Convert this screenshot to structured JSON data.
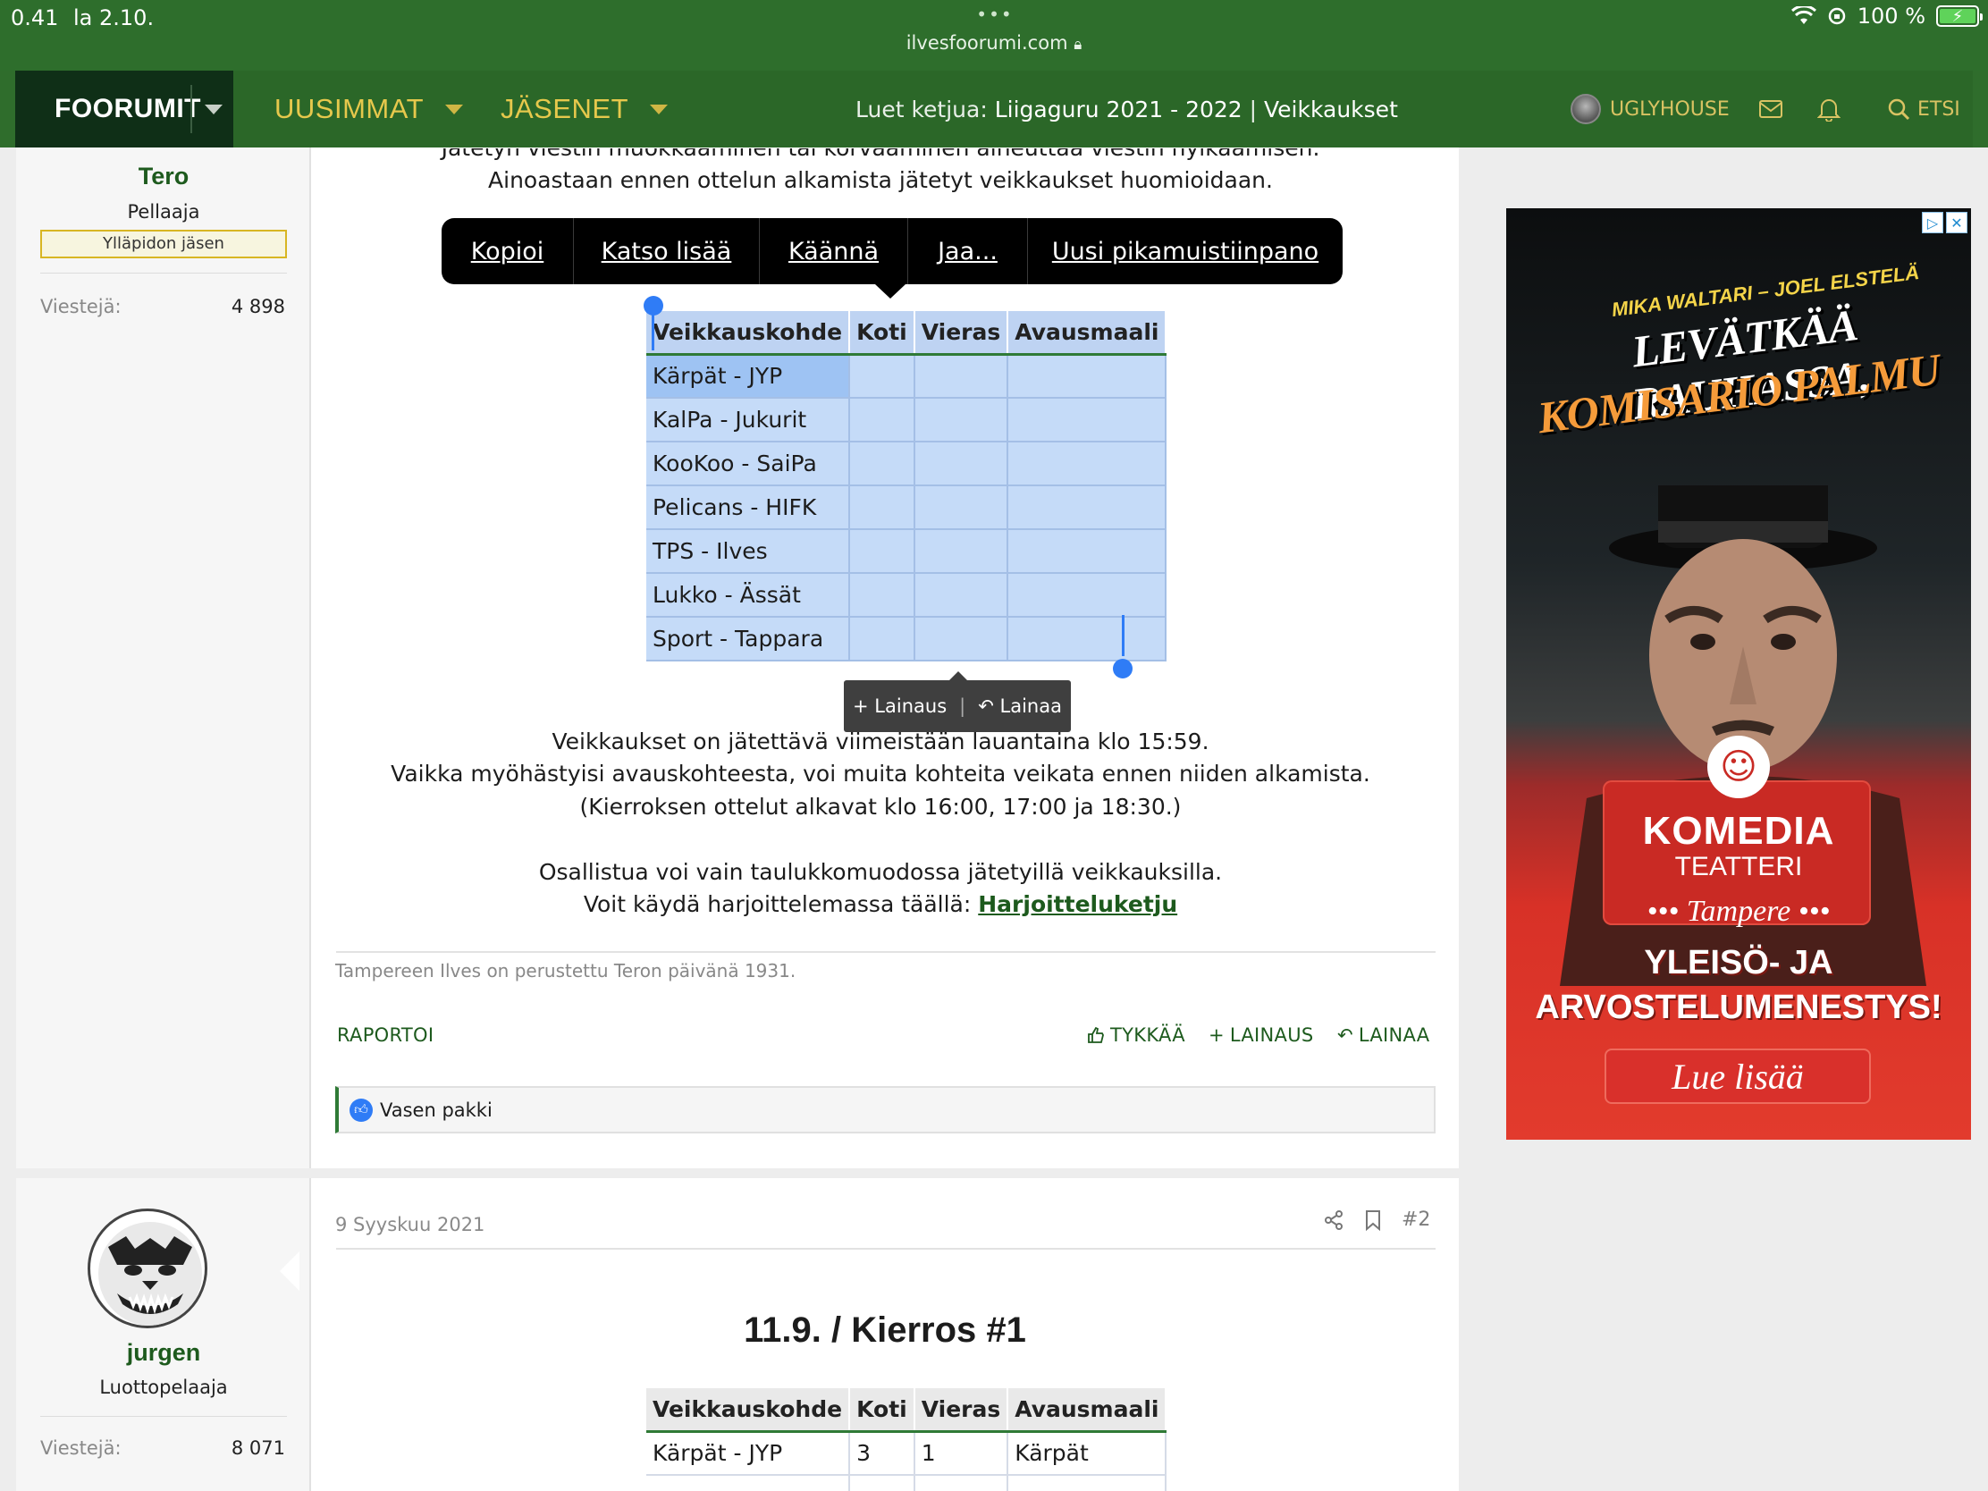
{
  "status_bar": {
    "time": "0.41",
    "date": "la 2.10.",
    "url": "ilvesfoorumi.com",
    "battery": "100 %"
  },
  "nav": {
    "forums": "FOORUMIT",
    "latest": "UUSIMMAT",
    "members": "JÄSENET",
    "reading_prefix": "Luet ketjua:",
    "thread_title": "Liigaguru 2021 - 2022",
    "forum_name": "Veikkaukset",
    "username": "UGLYHOUSE",
    "search": "ETSI"
  },
  "post1": {
    "author": "Tero",
    "role": "Pellaaja",
    "badge": "Ylläpidon jäsen",
    "stat_label": "Viestejä:",
    "stat_value": "4 898",
    "text_cut": "Jätetyn viestin muokkaaminen tai korvaaminen aiheuttaa viestin hylkäämisen.",
    "text_only": "Ainoastaan ennen ottelun alkamista jätetyt veikkaukset huomioidaan.",
    "context_menu": [
      "Kopioi",
      "Katso lisää",
      "Käännä",
      "Jaa...",
      "Uusi pikamuistiinpano"
    ],
    "table_headers": [
      "Veikkauskohde",
      "Koti",
      "Vieras",
      "Avausmaali"
    ],
    "table_rows": [
      [
        "Kärpät - JYP",
        "",
        "",
        ""
      ],
      [
        "KalPa - Jukurit",
        "",
        "",
        ""
      ],
      [
        "KooKoo - SaiPa",
        "",
        "",
        ""
      ],
      [
        "Pelicans - HIFK",
        "",
        "",
        ""
      ],
      [
        "TPS - Ilves",
        "",
        "",
        ""
      ],
      [
        "Lukko - Ässät",
        "",
        "",
        ""
      ],
      [
        "Sport - Tappara",
        "",
        "",
        ""
      ]
    ],
    "quote_popup": {
      "add": "Lainaus",
      "reply": "Lainaa"
    },
    "para1": "Veikkaukset on jätettävä viimeistään lauantaina klo 15:59.",
    "para2": "Vaikka myöhästyisi avauskohteesta, voi muita kohteita veikata ennen niiden alkamista.",
    "para3": "(Kierroksen ottelut alkavat klo 16:00, 17:00 ja 18:30.)",
    "para4": "Osallistua voi vain taulukkomuodossa jätetyillä veikkauksilla.",
    "para5_prefix": "Voit käydä harjoittelemassa täällä:",
    "para5_link": "Harjoitteluketju",
    "signature": "Tampereen Ilves on perustettu Teron päivänä 1931.",
    "report": "RAPORTOI",
    "like": "TYKKÄÄ",
    "add_quote": "LAINAUS",
    "reply": "LAINAA",
    "reaction_user": "Vasen pakki"
  },
  "post2": {
    "author": "jurgen",
    "role": "Luottopelaaja",
    "stat_label": "Viestejä:",
    "stat_value": "8 071",
    "date": "9 Syyskuu 2021",
    "number": "#2",
    "title": "11.9. / Kierros #1",
    "table_headers": [
      "Veikkauskohde",
      "Koti",
      "Vieras",
      "Avausmaali"
    ],
    "table_rows": [
      [
        "Kärpät - JYP",
        "3",
        "1",
        "Kärpät"
      ]
    ]
  },
  "ad": {
    "authors": "MIKA WALTARI – JOEL ELSTELÄ",
    "title1": "LEVÄTKÄÄ RAUHASSA,",
    "title2": "KOMISARIO PALMU",
    "brand": "KOMEDIA",
    "brand2": "TEATTERI",
    "city": "••• Tampere •••",
    "line1": "YLEISÖ- JA",
    "line2": "ARVOSTELUMENESTYS!",
    "cta": "Lue lisää"
  },
  "colors": {
    "header_green": "#2e6e2c",
    "nav_dark": "#0f2f17",
    "nav_gold": "#e6c84c",
    "link_green": "#1d5a1d",
    "selection_blue": "#c5dbf8",
    "handle_blue": "#2f7cf6"
  }
}
